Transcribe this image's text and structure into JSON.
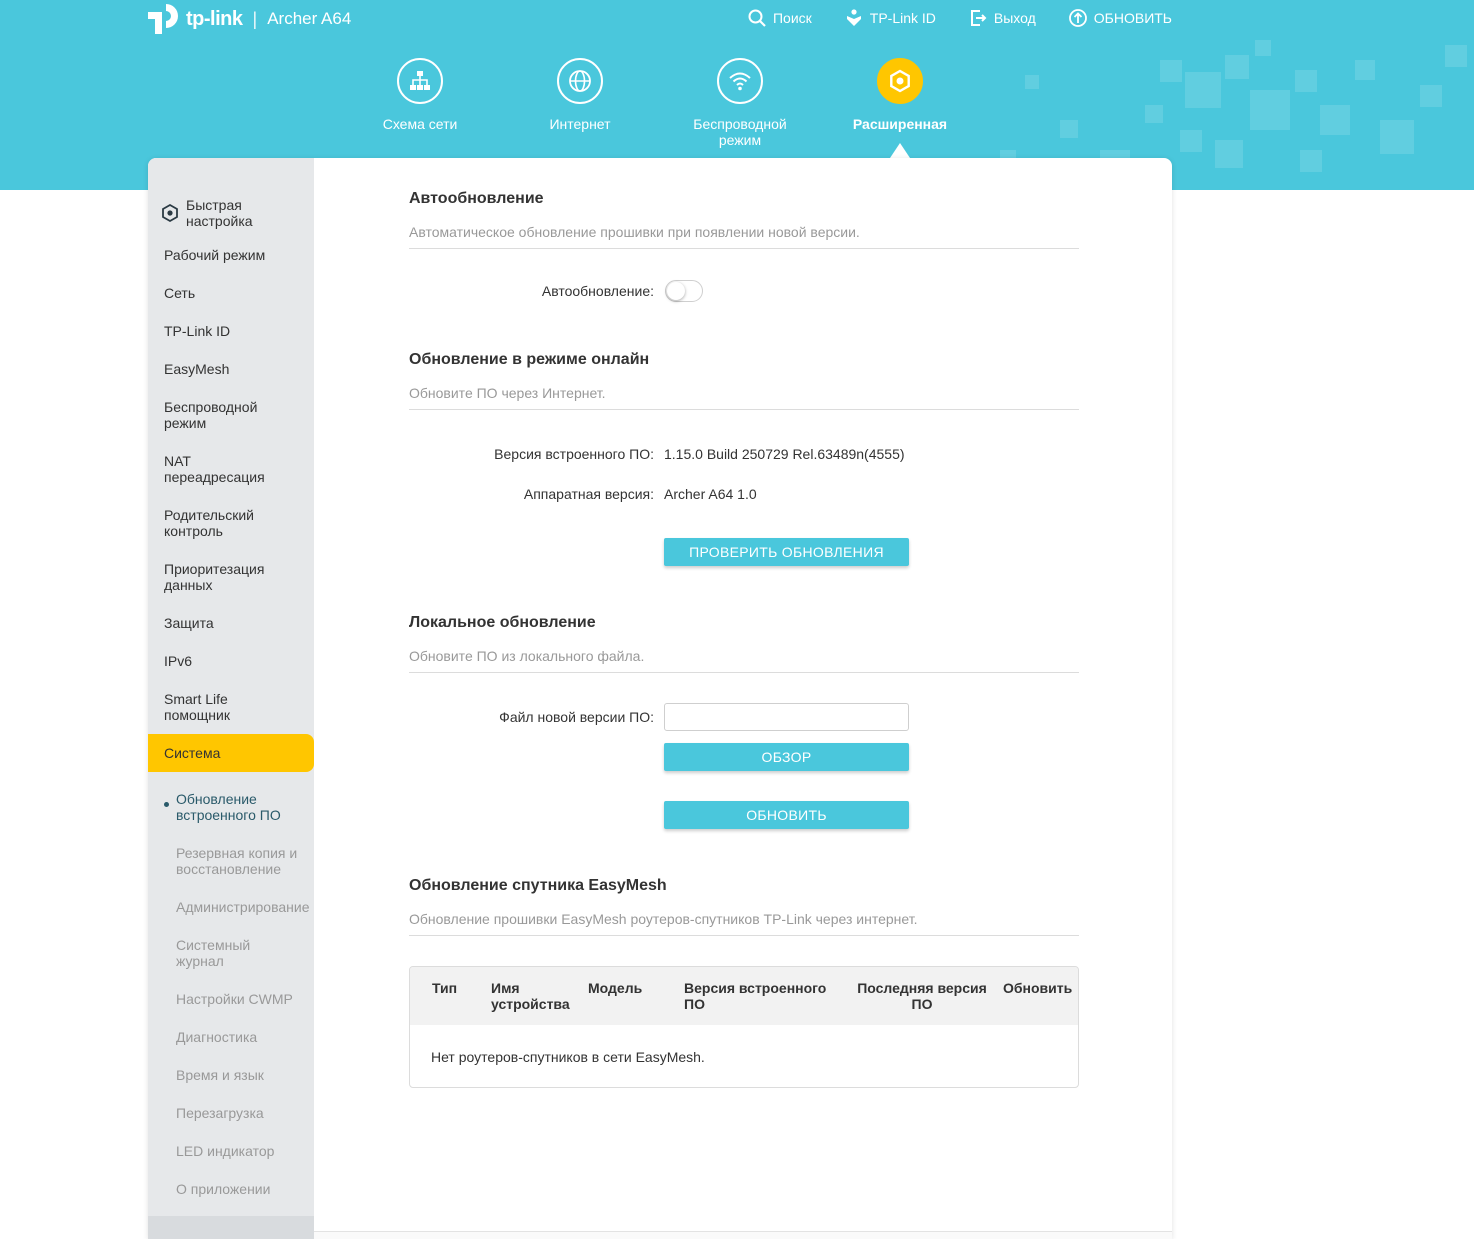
{
  "header": {
    "brand": "tp-link",
    "model": "Archer A64",
    "nav": [
      {
        "label": "Поиск",
        "icon": "search-icon"
      },
      {
        "label": "TP-Link ID",
        "icon": "tplink-id-icon"
      },
      {
        "label": "Выход",
        "icon": "logout-icon"
      },
      {
        "label": "ОБНОВИТЬ",
        "icon": "update-icon"
      }
    ]
  },
  "main_tabs": [
    {
      "label": "Схема сети",
      "icon": "network-map-icon"
    },
    {
      "label": "Интернет",
      "icon": "globe-icon"
    },
    {
      "label": "Беспроводной режим",
      "icon": "wifi-icon"
    },
    {
      "label": "Расширенная",
      "icon": "advanced-gear-icon",
      "active": true
    }
  ],
  "sidebar": {
    "items": [
      {
        "label": "Быстрая настройка",
        "icon": "quick-setup-icon"
      },
      {
        "label": "Рабочий режим"
      },
      {
        "label": "Сеть"
      },
      {
        "label": "TP-Link ID"
      },
      {
        "label": "EasyMesh"
      },
      {
        "label": "Беспроводной режим"
      },
      {
        "label": "NAT переадресация"
      },
      {
        "label": "Родительский контроль"
      },
      {
        "label": "Приоритезация данных"
      },
      {
        "label": "Защита"
      },
      {
        "label": "IPv6"
      },
      {
        "label": "Smart Life помощник"
      },
      {
        "label": "Система",
        "active": true
      }
    ],
    "subitems": [
      {
        "label": "Обновление встроенного ПО",
        "current": true
      },
      {
        "label": "Резервная копия и восстановление"
      },
      {
        "label": "Администрирование"
      },
      {
        "label": "Системный журнал"
      },
      {
        "label": "Настройки CWMP"
      },
      {
        "label": "Диагностика"
      },
      {
        "label": "Время и язык"
      },
      {
        "label": "Перезагрузка"
      },
      {
        "label": "LED индикатор"
      },
      {
        "label": "О приложении"
      }
    ]
  },
  "auto": {
    "title": "Автообновление",
    "desc": "Автоматическое обновление прошивки при появлении новой версии.",
    "label": "Автообновление:",
    "enabled": false
  },
  "online": {
    "title": "Обновление в режиме онлайн",
    "desc": "Обновите ПО через Интернет.",
    "fw_label": "Версия встроенного ПО:",
    "fw_value": "1.15.0 Build 250729 Rel.63489n(4555)",
    "hw_label": "Аппаратная версия:",
    "hw_value": "Archer A64 1.0",
    "check_button": "ПРОВЕРИТЬ ОБНОВЛЕНИЯ"
  },
  "local": {
    "title": "Локальное обновление",
    "desc": "Обновите ПО из локального файла.",
    "file_label": "Файл новой версии ПО:",
    "file_value": "",
    "browse_button": "ОБЗОР",
    "update_button": "ОБНОВИТЬ"
  },
  "easymesh": {
    "title": "Обновление спутника EasyMesh",
    "desc": "Обновление прошивки EasyMesh роутеров-спутников TP-Link через интернет.",
    "columns": [
      "Тип",
      "Имя устройства",
      "Модель",
      "Версия встроенного ПО",
      "Последняя версия ПО",
      "Обновить"
    ],
    "empty": "Нет роутеров-спутников в сети EasyMesh."
  },
  "colors": {
    "accent": "#4ac7dc",
    "active": "#ffc600",
    "sidebar": "#e6e8ea"
  }
}
